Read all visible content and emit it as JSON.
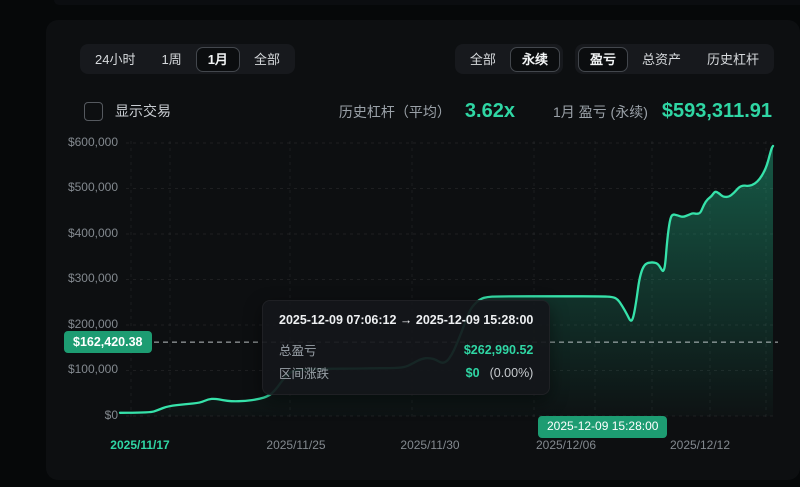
{
  "colors": {
    "accent_green": "#2fd6a4",
    "line_green": "#36e2aa",
    "badge_green": "#1d9c72",
    "page_bg": "#060809",
    "card_bg": "#0d0f11"
  },
  "toolbar": {
    "time_ranges": [
      {
        "label": "24小时",
        "active": false
      },
      {
        "label": "1周",
        "active": false
      },
      {
        "label": "1月",
        "active": true
      },
      {
        "label": "全部",
        "active": false
      }
    ],
    "scope_group": [
      {
        "label": "全部",
        "active": false
      },
      {
        "label": "永续",
        "active": true
      }
    ],
    "metric_group": [
      {
        "label": "盈亏",
        "active": true
      },
      {
        "label": "总资产",
        "active": false
      },
      {
        "label": "历史杠杆",
        "active": false
      }
    ]
  },
  "subheader": {
    "show_trades_label": "显示交易",
    "checkbox_checked": false,
    "stats": [
      {
        "label": "历史杠杆（平均）",
        "value": "3.62x"
      },
      {
        "label": "1月 盈亏 (永续)",
        "value": "$593,311.91"
      }
    ]
  },
  "tooltip": {
    "title": "2025-12-09 07:06:12 → 2025-12-09 15:28:00",
    "rows": [
      {
        "label": "总盈亏",
        "value": "$262,990.52",
        "extra": ""
      },
      {
        "label": "区间涨跌",
        "value": "$0",
        "extra": "(0.00%)"
      }
    ]
  },
  "chart_data": {
    "type": "area",
    "title": "1月 盈亏 (永续)",
    "ylim": [
      0,
      600000
    ],
    "grid": true,
    "yticks": [
      "$600,000",
      "$500,000",
      "$400,000",
      "$300,000",
      "$200,000",
      "$100,000",
      "$0"
    ],
    "xticks": [
      "2025/11/17",
      "2025/11/25",
      "2025/11/30",
      "2025/12/06",
      "2025/12/12"
    ],
    "ref_line": {
      "label": "$162,420.38",
      "value": 162420.38
    },
    "end_marker": {
      "label": "2025-12-09 15:28:00"
    },
    "series": [
      {
        "name": "总盈亏",
        "points": [
          [
            0.0,
            7000
          ],
          [
            0.046,
            7000
          ],
          [
            0.058,
            13000
          ],
          [
            0.074,
            22000
          ],
          [
            0.1,
            26000
          ],
          [
            0.123,
            29000
          ],
          [
            0.135,
            37000
          ],
          [
            0.146,
            38000
          ],
          [
            0.157,
            35000
          ],
          [
            0.172,
            32000
          ],
          [
            0.192,
            33000
          ],
          [
            0.212,
            37000
          ],
          [
            0.228,
            44000
          ],
          [
            0.238,
            57000
          ],
          [
            0.249,
            79000
          ],
          [
            0.258,
            94000
          ],
          [
            0.269,
            101000
          ],
          [
            0.292,
            103000
          ],
          [
            0.323,
            104000
          ],
          [
            0.354,
            104000
          ],
          [
            0.385,
            105000
          ],
          [
            0.423,
            105000
          ],
          [
            0.438,
            108000
          ],
          [
            0.449,
            116000
          ],
          [
            0.462,
            126000
          ],
          [
            0.474,
            128000
          ],
          [
            0.485,
            123000
          ],
          [
            0.492,
            116000
          ],
          [
            0.5,
            119000
          ],
          [
            0.508,
            134000
          ],
          [
            0.515,
            156000
          ],
          [
            0.523,
            184000
          ],
          [
            0.531,
            215000
          ],
          [
            0.538,
            239000
          ],
          [
            0.551,
            257000
          ],
          [
            0.563,
            262000
          ],
          [
            0.577,
            263000
          ],
          [
            0.677,
            263000
          ],
          [
            0.738,
            263000
          ],
          [
            0.754,
            262000
          ],
          [
            0.762,
            257000
          ],
          [
            0.769,
            242000
          ],
          [
            0.777,
            222000
          ],
          [
            0.782,
            207000
          ],
          [
            0.786,
            215000
          ],
          [
            0.791,
            255000
          ],
          [
            0.795,
            299000
          ],
          [
            0.8,
            325000
          ],
          [
            0.806,
            336000
          ],
          [
            0.815,
            338000
          ],
          [
            0.823,
            336000
          ],
          [
            0.828,
            325000
          ],
          [
            0.832,
            316000
          ],
          [
            0.835,
            332000
          ],
          [
            0.838,
            387000
          ],
          [
            0.842,
            431000
          ],
          [
            0.846,
            444000
          ],
          [
            0.854,
            441000
          ],
          [
            0.862,
            437000
          ],
          [
            0.871,
            442000
          ],
          [
            0.877,
            446000
          ],
          [
            0.883,
            444000
          ],
          [
            0.889,
            446000
          ],
          [
            0.894,
            464000
          ],
          [
            0.9,
            477000
          ],
          [
            0.906,
            483000
          ],
          [
            0.911,
            494000
          ],
          [
            0.917,
            490000
          ],
          [
            0.923,
            482000
          ],
          [
            0.932,
            481000
          ],
          [
            0.94,
            490000
          ],
          [
            0.948,
            503000
          ],
          [
            0.955,
            507000
          ],
          [
            0.963,
            505000
          ],
          [
            0.972,
            510000
          ],
          [
            0.98,
            521000
          ],
          [
            0.986,
            536000
          ],
          [
            0.991,
            552000
          ],
          [
            0.995,
            574000
          ],
          [
            0.998,
            589000
          ],
          [
            1.0,
            593311.91
          ]
        ]
      }
    ]
  }
}
